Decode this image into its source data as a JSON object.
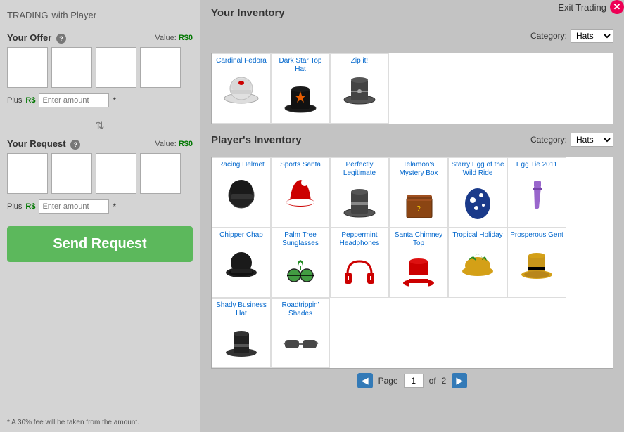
{
  "header": {
    "title": "TRADING",
    "subtitle": "with Player",
    "exit_label": "Exit Trading"
  },
  "left": {
    "your_offer": {
      "label": "Your Offer",
      "value_label": "Value:",
      "value": "R$0"
    },
    "plus_label": "Plus R$",
    "robux_placeholder": "Enter amount",
    "your_request": {
      "label": "Your Request",
      "value_label": "Value:",
      "value": "R$0"
    },
    "send_button": "Send Request",
    "fee_note": "* A 30% fee will be taken from the amount."
  },
  "your_inventory": {
    "title": "Your Inventory",
    "category_label": "Category:",
    "category_value": "Hats",
    "items": [
      {
        "name": "Cardinal Fedora",
        "color": "#e8e8e8",
        "hat_type": "cardinal"
      },
      {
        "name": "Dark Star Top Hat",
        "color": "#1a1a1a",
        "hat_type": "darkstar"
      },
      {
        "name": "Zip it!",
        "color": "#444",
        "hat_type": "zipit"
      }
    ]
  },
  "player_inventory": {
    "title": "Player's Inventory",
    "category_label": "Category:",
    "category_value": "Hats",
    "items": [
      {
        "name": "Racing Helmet",
        "color": "#222",
        "hat_type": "helmet"
      },
      {
        "name": "Sports Santa",
        "color": "#cc0000",
        "hat_type": "santa"
      },
      {
        "name": "Perfectly Legitimate",
        "color": "#555",
        "hat_type": "tophat"
      },
      {
        "name": "Telamon's Mystery Box",
        "color": "#8B4513",
        "hat_type": "box"
      },
      {
        "name": "Starry Egg of the Wild Ride",
        "color": "#1a3a8a",
        "hat_type": "egg"
      },
      {
        "name": "Egg Tie 2011",
        "color": "#9966cc",
        "hat_type": "tie"
      },
      {
        "name": "Chipper Chap",
        "color": "#222",
        "hat_type": "chap"
      },
      {
        "name": "Palm Tree Sunglasses",
        "color": "#228b22",
        "hat_type": "sunglasses"
      },
      {
        "name": "Peppermint Headphones",
        "color": "#cc0000",
        "hat_type": "headphones"
      },
      {
        "name": "Santa Chimney Top",
        "color": "#cc0000",
        "hat_type": "chimney"
      },
      {
        "name": "Tropical Holiday",
        "color": "#228b22",
        "hat_type": "tropical"
      },
      {
        "name": "Prosperous Gent",
        "color": "#d4a017",
        "hat_type": "gent"
      },
      {
        "name": "Shady Business Hat",
        "color": "#333",
        "hat_type": "shadybiz"
      },
      {
        "name": "Roadtrippin' Shades",
        "color": "#333",
        "hat_type": "shades"
      }
    ],
    "page_current": "1",
    "page_total": "2"
  }
}
